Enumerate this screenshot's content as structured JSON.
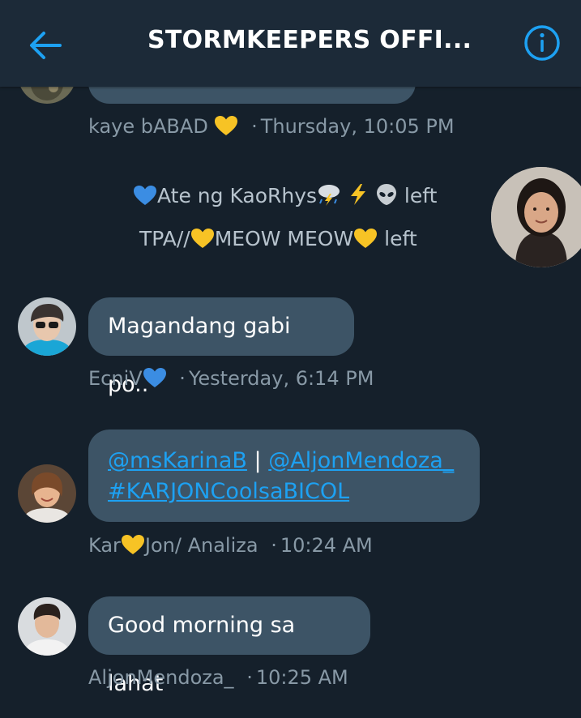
{
  "header": {
    "title": "STORMKEEPERS OFFI...",
    "back_icon": "arrow-left-icon",
    "info_icon": "info-circle-icon",
    "accent_color": "#1da1f2"
  },
  "messages": [
    {
      "sender": "kaye bABAD",
      "sender_emoji": "yellow-heart",
      "timestamp": "Thursday, 10:05 PM"
    },
    {
      "sender": "EcniV",
      "sender_emoji": "blue-heart",
      "text": "Magandang gabi po..",
      "timestamp": "Yesterday, 6:14 PM"
    },
    {
      "sender_prefix": "Kar",
      "sender_suffix": "Jon/ Analiza",
      "sender_emoji": "yellow-heart",
      "link1": "@msKarinaB",
      "separator": "|",
      "link2": "@AljonMendoza_",
      "link3": "#KARJONCoolsaBICOL",
      "timestamp": "10:24 AM"
    },
    {
      "sender": "AljonMendoza_",
      "text": "Good morning sa lahat",
      "timestamp": "10:25 AM"
    }
  ],
  "system_events": [
    {
      "name": "Ate ng KaoRhys",
      "emojis": [
        "blue-heart",
        "thunder-cloud-rain",
        "lightning",
        "alien"
      ],
      "action": "left"
    },
    {
      "name_prefix": "TPA//",
      "name_middle": "MEOW MEOW",
      "emojis": [
        "yellow-heart",
        "yellow-heart"
      ],
      "action": "left"
    }
  ],
  "dot_separator": "·",
  "colors": {
    "background": "#15202b",
    "header": "#1c2a38",
    "bubble": "#3d5466",
    "meta_text": "#8899a6",
    "yellow_heart": "#f7c325",
    "blue_heart": "#3b8de3"
  }
}
